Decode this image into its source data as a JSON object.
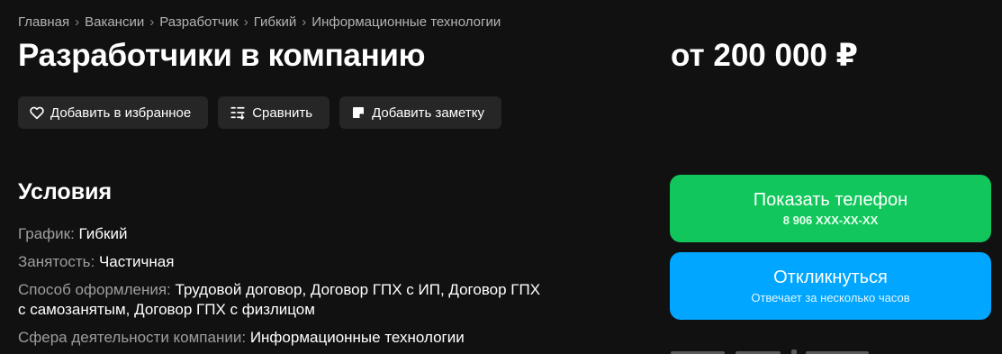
{
  "breadcrumb": {
    "items": [
      "Главная",
      "Вакансии",
      "Разработчик",
      "Гибкий",
      "Информационные технологии"
    ],
    "separator": "›"
  },
  "title": "Разработчики в компанию",
  "salary": "от 200 000 ₽",
  "actions": {
    "favorite": "Добавить в избранное",
    "compare": "Сравнить",
    "note": "Добавить заметку"
  },
  "conditions": {
    "title": "Условия",
    "schedule": {
      "label": "График:",
      "value": "Гибкий"
    },
    "employment": {
      "label": "Занятость:",
      "value": "Частичная"
    },
    "contract": {
      "label": "Способ оформления:",
      "value_line1": "Трудовой договор, Договор ГПХ с ИП, Договор ГПХ",
      "value_line2": "с самозанятым, Договор ГПХ с физлицом"
    },
    "sphere": {
      "label": "Сфера деятельности компании:",
      "value": "Информационные технологии"
    }
  },
  "cta": {
    "phone_label": "Показать телефон",
    "phone_number": "8 906 XXX-XX-XX",
    "respond_label": "Откликнуться",
    "respond_sub": "Отвечает за несколько часов"
  },
  "colors": {
    "background": "#111111",
    "button_bg": "#262626",
    "phone_green": "#11c75c",
    "respond_blue": "#00a6ff",
    "muted_text": "#9e9e9e"
  },
  "icons": [
    "heart-icon",
    "compare-icon",
    "note-icon"
  ]
}
